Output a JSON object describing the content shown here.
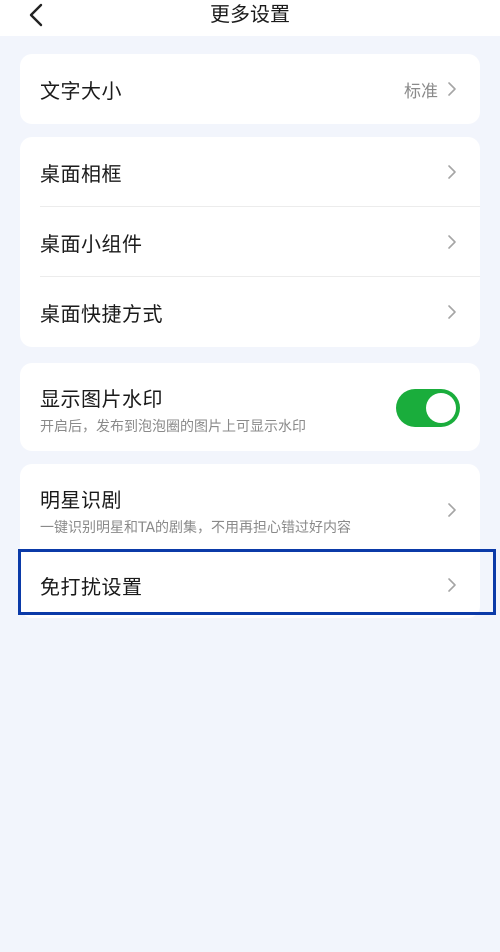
{
  "header": {
    "title": "更多设置"
  },
  "font_size": {
    "label": "文字大小",
    "value": "标准"
  },
  "desktop": {
    "items": [
      {
        "label": "桌面相框"
      },
      {
        "label": "桌面小组件"
      },
      {
        "label": "桌面快捷方式"
      }
    ]
  },
  "watermark": {
    "label": "显示图片水印",
    "description": "开启后，发布到泡泡圈的图片上可显示水印",
    "enabled": true
  },
  "star_recognition": {
    "label": "明星识剧",
    "description": "一键识别明星和TA的剧集，不用再担心错过好内容"
  },
  "do_not_disturb": {
    "label": "免打扰设置"
  },
  "colors": {
    "background": "#f2f5fc",
    "toggle_on": "#1aad3c",
    "highlight": "#0b3aa8"
  },
  "icons": {
    "back": "chevron-left-icon",
    "row_arrow": "chevron-right-icon"
  }
}
